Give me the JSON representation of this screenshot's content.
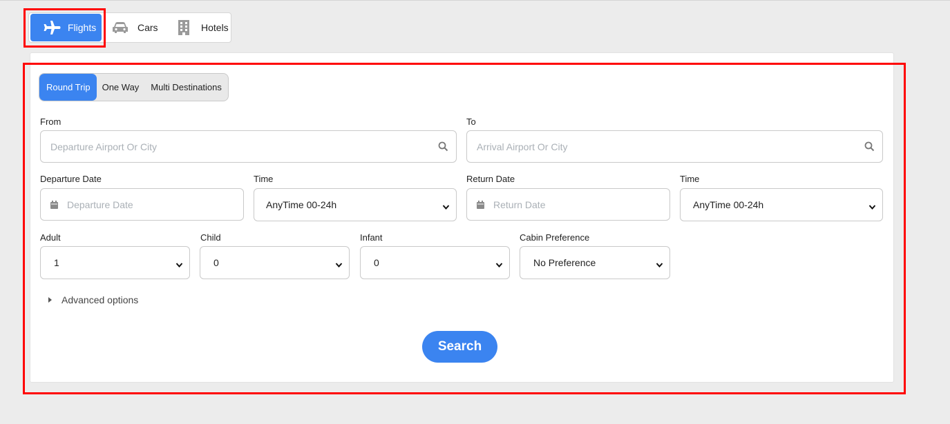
{
  "product_tabs": [
    {
      "label": "Flights",
      "icon": "airplane-icon",
      "active": true
    },
    {
      "label": "Cars",
      "icon": "car-icon",
      "active": false
    },
    {
      "label": "Hotels",
      "icon": "building-icon",
      "active": false
    }
  ],
  "trip_types": [
    {
      "label": "Round Trip",
      "active": true
    },
    {
      "label": "One Way",
      "active": false
    },
    {
      "label": "Multi Destinations",
      "active": false
    }
  ],
  "from": {
    "label": "From",
    "placeholder": "Departure Airport Or City",
    "value": ""
  },
  "to": {
    "label": "To",
    "placeholder": "Arrival Airport Or City",
    "value": ""
  },
  "departure_date": {
    "label": "Departure Date",
    "placeholder": "Departure Date",
    "value": ""
  },
  "departure_time": {
    "label": "Time",
    "value": "AnyTime 00-24h"
  },
  "return_date": {
    "label": "Return Date",
    "placeholder": "Return Date",
    "value": ""
  },
  "return_time": {
    "label": "Time",
    "value": "AnyTime 00-24h"
  },
  "adult": {
    "label": "Adult",
    "value": "1"
  },
  "child": {
    "label": "Child",
    "value": "0"
  },
  "infant": {
    "label": "Infant",
    "value": "0"
  },
  "cabin": {
    "label": "Cabin Preference",
    "value": "No Preference"
  },
  "advanced_options": "Advanced options",
  "search_button": "Search",
  "colors": {
    "accent": "#3b84f0",
    "highlight": "#ff0000",
    "background": "#ececec"
  }
}
